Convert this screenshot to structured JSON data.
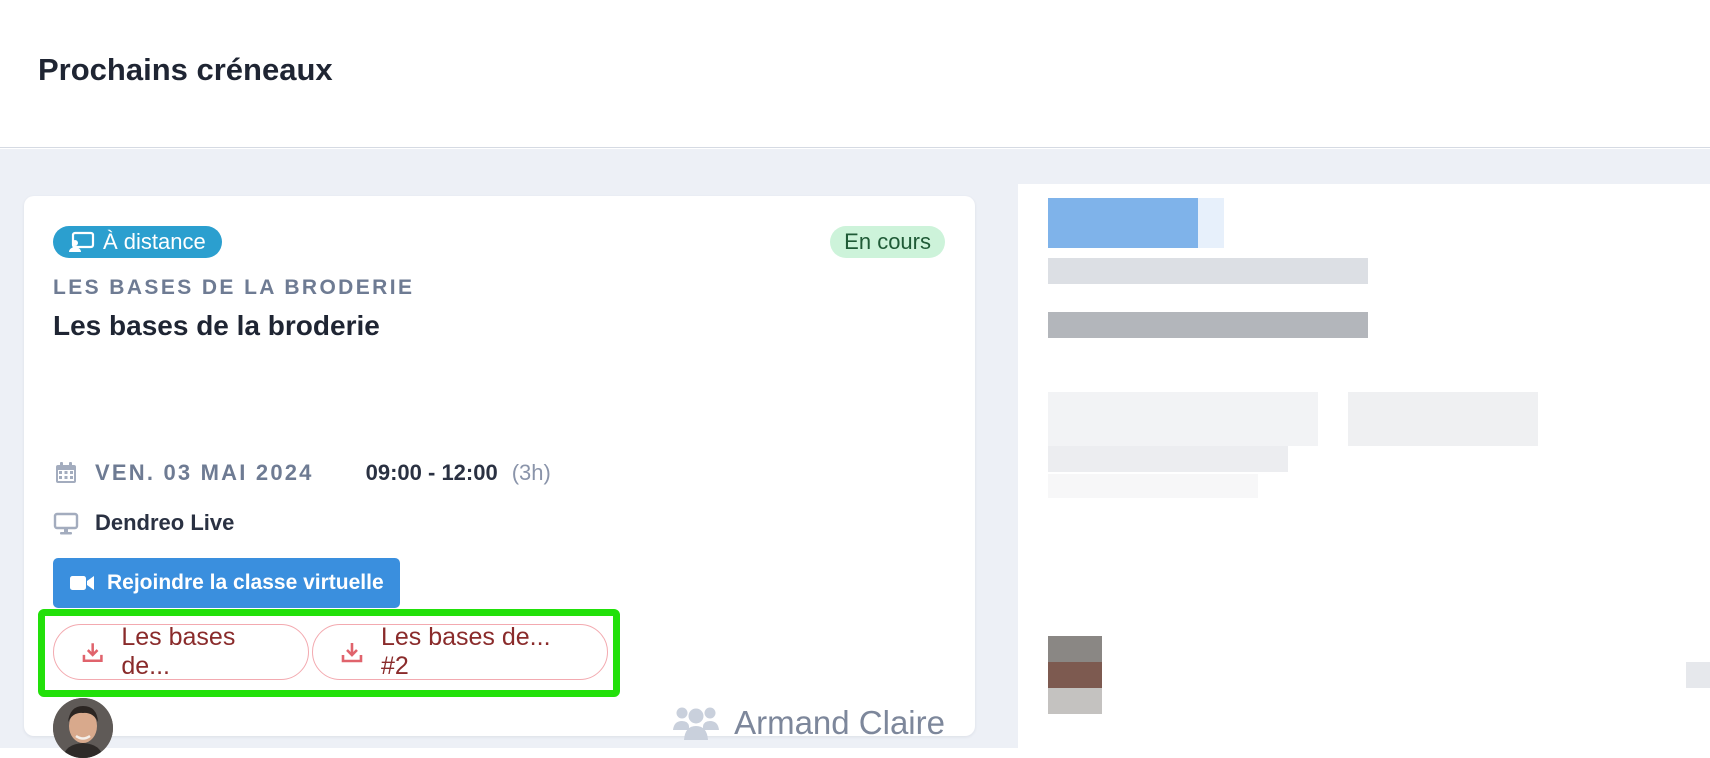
{
  "header": {
    "title": "Prochains créneaux"
  },
  "session_card": {
    "mode_badge": {
      "label": "À distance",
      "icon": "remote-screen-icon"
    },
    "status_badge": {
      "label": "En cours"
    },
    "course_overline": "LES BASES DE LA BRODERIE",
    "session_title": "Les bases de la broderie",
    "date": "VEN. 03 MAI 2024",
    "time_range": "09:00 - 12:00",
    "duration": "(3h)",
    "location": {
      "label": "Dendreo Live",
      "icon": "monitor-icon"
    },
    "join_button": {
      "label": "Rejoindre la classe virtuelle",
      "icon": "video-camera-icon"
    },
    "documents": [
      {
        "label": "Les bases de...",
        "icon": "download-icon"
      },
      {
        "label": "Les bases de... #2",
        "icon": "download-icon"
      }
    ],
    "trainer": {
      "name": "Armand Claire",
      "icon": "users-icon"
    }
  },
  "colors": {
    "mode_badge_bg": "#2b9fcf",
    "status_badge_bg": "#cdf3da",
    "join_button_bg": "#3a8fde",
    "highlight_box": "#22e00a",
    "document_chip_border": "#f3aab0"
  }
}
